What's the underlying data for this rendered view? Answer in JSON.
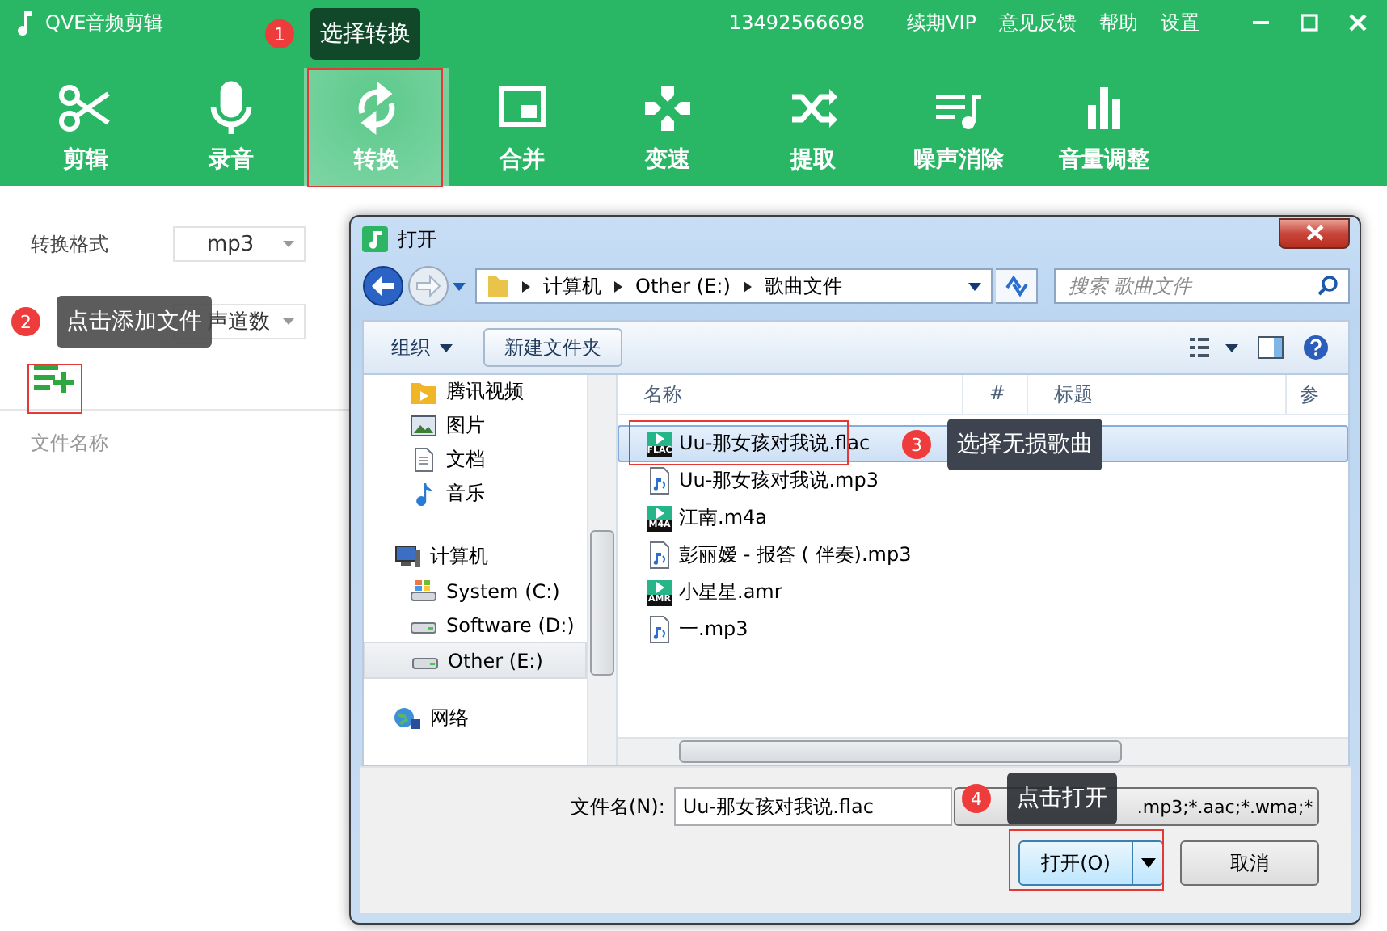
{
  "app": {
    "title": "QVE音频剪辑",
    "phone": "13492566698",
    "links": [
      "续期VIP",
      "意见反馈",
      "帮助",
      "设置"
    ]
  },
  "tabs": [
    {
      "label": "剪辑",
      "kind": "scissors",
      "selected": false
    },
    {
      "label": "录音",
      "kind": "mic",
      "selected": false
    },
    {
      "label": "转换",
      "kind": "convert",
      "selected": true
    },
    {
      "label": "合并",
      "kind": "merge",
      "selected": false
    },
    {
      "label": "变速",
      "kind": "dpad",
      "selected": false
    },
    {
      "label": "提取",
      "kind": "shuffle",
      "selected": false
    },
    {
      "label": "噪声消除",
      "kind": "playlist",
      "selected": false
    },
    {
      "label": "音量调整",
      "kind": "bars",
      "selected": false
    }
  ],
  "settings": [
    {
      "label": "转换格式",
      "value": "mp3"
    },
    {
      "value": "声道数"
    }
  ],
  "file_list": {
    "header": "文件名称"
  },
  "dialog": {
    "title": "打开",
    "path": [
      "计算机",
      "Other (E:)",
      "歌曲文件"
    ],
    "search_placeholder": "搜索 歌曲文件",
    "organize": "组织",
    "new_folder": "新建文件夹",
    "nav": [
      {
        "label": "腾讯视频",
        "kind": "video-folder",
        "selected": false
      },
      {
        "label": "图片",
        "kind": "pictures",
        "selected": false
      },
      {
        "label": "文档",
        "kind": "document",
        "selected": false
      },
      {
        "label": "音乐",
        "kind": "music",
        "selected": false
      },
      {
        "label": "计算机",
        "kind": "computer",
        "selected": false,
        "children": [
          {
            "label": "System (C:)",
            "kind": "system-drive",
            "selected": false
          },
          {
            "label": "Software (D:)",
            "kind": "drive",
            "selected": false
          },
          {
            "label": "Other (E:)",
            "kind": "drive",
            "selected": true
          }
        ]
      },
      {
        "label": "网络",
        "kind": "network",
        "selected": false
      }
    ],
    "columns": [
      "名称",
      "#",
      "标题",
      "参"
    ],
    "files": [
      {
        "name": "Uu-那女孩对我说.flac",
        "kind": "tagged",
        "badge": "FLAC",
        "selected": true
      },
      {
        "name": "Uu-那女孩对我说.mp3",
        "kind": "plain",
        "selected": false
      },
      {
        "name": "江南.m4a",
        "kind": "tagged",
        "badge": "M4A",
        "selected": false
      },
      {
        "name": "彭丽嫒 - 报答 ( 伴奏).mp3",
        "kind": "plain",
        "selected": false
      },
      {
        "name": "小星星.amr",
        "kind": "tagged",
        "badge": "AMR",
        "selected": false
      },
      {
        "name": "一.mp3",
        "kind": "plain",
        "selected": false
      }
    ],
    "filename_label": "文件名(N):",
    "filename": "Uu-那女孩对我说.flac",
    "filetype": ".mp3;*.aac;*.wma;*",
    "open": "打开(O)",
    "cancel": "取消"
  },
  "annotations": [
    {
      "number": "1",
      "text": "选择转换"
    },
    {
      "number": "2",
      "text": "点击添加文件"
    },
    {
      "number": "3",
      "text": "选择无损歌曲"
    },
    {
      "number": "4",
      "text": "点击打开"
    }
  ]
}
